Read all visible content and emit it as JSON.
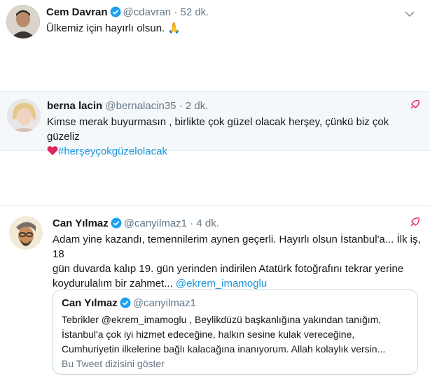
{
  "tweets": [
    {
      "name": "Cem Davran",
      "handle": "@cdavran",
      "time": "52 dk.",
      "text": "Ülkemiz için hayırlı olsun.",
      "emoji": "🙏"
    },
    {
      "name": "berna lacin",
      "handle": "@bernalacin35",
      "time": "2 dk.",
      "text": "Kimse merak buyurmasın , birlikte çok güzel olacak herşey, çünkü biz çok güzeliz",
      "hashtag": "#herşeyçokgüzelolacak"
    },
    {
      "name": "Can Yılmaz",
      "handle": "@canyilmaz1",
      "time": "4 dk.",
      "text_line1": "Adam yine kazandı, temennilerim aynen geçerli. Hayırlı olsun İstanbul'a... İlk iş, 18",
      "text_line2": "gün duvarda kalıp 19. gün yerinden indirilen Atatürk fotoğrafını tekrar yerine",
      "text_line3": "koydurulalım bir zahmet...",
      "mention": "@ekrem_imamoglu",
      "quote": {
        "name": "Can Yılmaz",
        "handle": "@canyilmaz1",
        "line1": "Tebrikler @ekrem_imamoglu , Beylikdüzü başkanlığına yakından tanığım,",
        "line2": "İstanbul'a çok iyi hizmet edeceğine, halkın sesine kulak vereceğine,",
        "line3": "Cumhuriyetin ilkelerine bağlı kalacağına inanıyorum. Allah kolaylık versin...",
        "thread_link": "Bu Tweet dizisini göster"
      }
    }
  ],
  "separator": "·",
  "colors": {
    "accent": "#1da1f2",
    "link": "#1b95e0",
    "heart": "#e0245e",
    "highlight_bg": "#f5f8fa"
  }
}
